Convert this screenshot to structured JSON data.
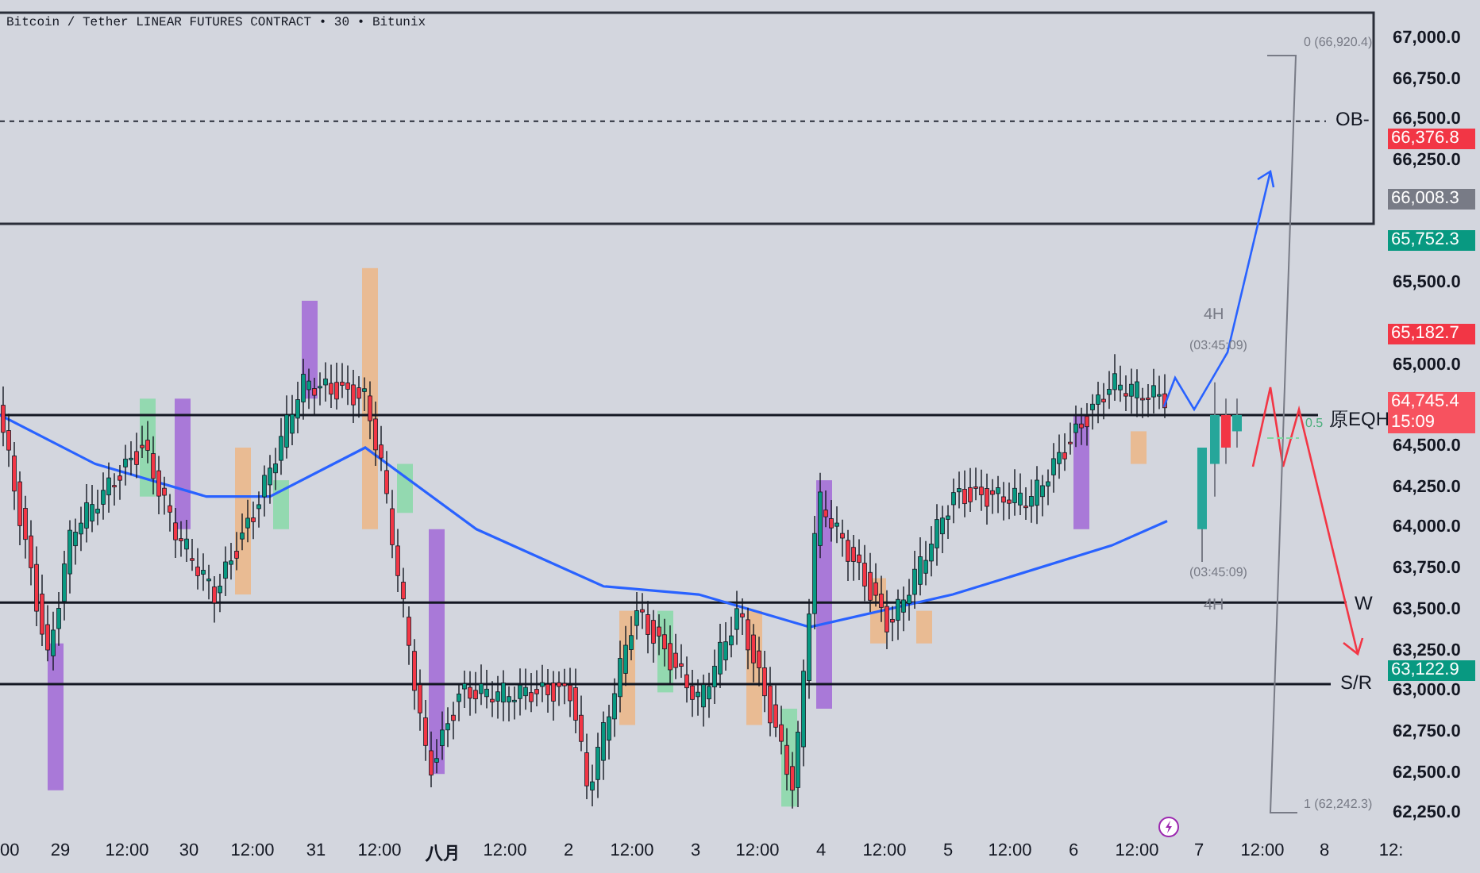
{
  "title": "Bitcoin / Tether LINEAR FUTURES CONTRACT • 30 • Bitunix",
  "annotations": {
    "ob_label": "OB-",
    "eqh_label": "原EQH",
    "w_label": "W",
    "sr_label": "S/R",
    "fib_top": "0 (66,920.4)",
    "fib_mid": "0.5",
    "fib_bottom": "1 (62,242.3)",
    "tf_top": "4H",
    "timer_top": "(03:45:09)",
    "timer_bottom": "(03:45:09)",
    "tf_bottom": "4H"
  },
  "price_axis": {
    "labels": [
      "67,000.0",
      "66,750.0",
      "66,500.0",
      "66,250.0",
      "65,500.0",
      "65,000.0",
      "64,500.0",
      "64,250.0",
      "64,000.0",
      "63,750.0",
      "63,500.0",
      "63,250.0",
      "63,000.0",
      "62,750.0",
      "62,500.0",
      "62,250.0"
    ]
  },
  "price_badges": [
    {
      "price": "66,376.8",
      "color": "#f23645"
    },
    {
      "price": "66,008.3",
      "color": "#787b86"
    },
    {
      "price": "65,752.3",
      "color": "#089981"
    },
    {
      "price": "65,182.7",
      "color": "#f23645"
    },
    {
      "price": "64,745.4",
      "countdown": "15:09",
      "color": "#f7525f"
    },
    {
      "price": "63,122.9",
      "color": "#089981"
    }
  ],
  "time_axis": {
    "labels": [
      "00",
      "29",
      "12:00",
      "30",
      "12:00",
      "31",
      "12:00",
      "八月",
      "12:00",
      "2",
      "12:00",
      "3",
      "12:00",
      "4",
      "12:00",
      "5",
      "12:00",
      "6",
      "12:00",
      "7",
      "12:00",
      "8",
      "12:"
    ]
  }
}
